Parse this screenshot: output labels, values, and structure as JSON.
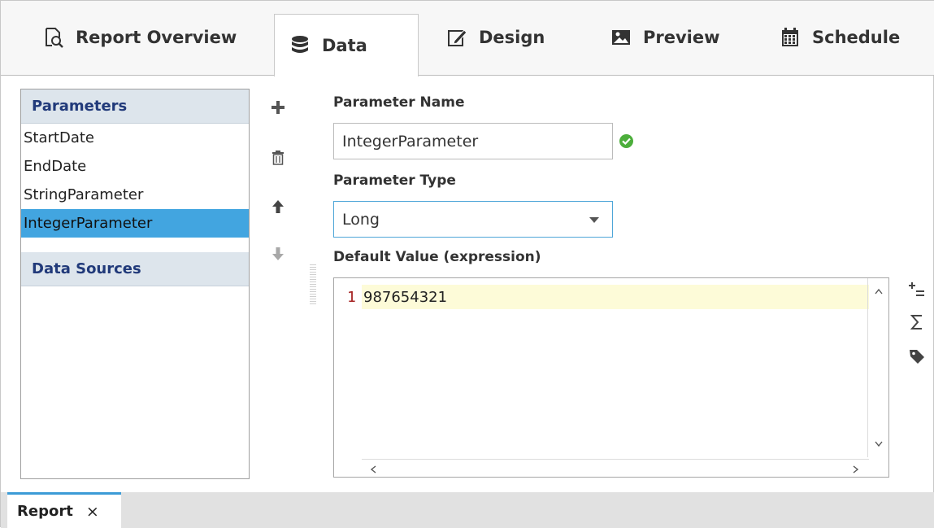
{
  "tabs": [
    {
      "label": "Report Overview",
      "icon": "report-overview-icon"
    },
    {
      "label": "Data",
      "icon": "database-icon"
    },
    {
      "label": "Design",
      "icon": "design-edit-icon"
    },
    {
      "label": "Preview",
      "icon": "image-preview-icon"
    },
    {
      "label": "Schedule",
      "icon": "calendar-icon"
    }
  ],
  "active_tab": "Data",
  "left_panel": {
    "parameters_header": "Parameters",
    "parameters": [
      "StartDate",
      "EndDate",
      "StringParameter",
      "IntegerParameter"
    ],
    "selected_parameter": "IntegerParameter",
    "datasources_header": "Data Sources"
  },
  "form": {
    "param_name_label": "Parameter Name",
    "param_name_value": "IntegerParameter",
    "param_type_label": "Parameter Type",
    "param_type_value": "Long",
    "default_value_label": "Default Value (expression)"
  },
  "editor": {
    "line_number": "1",
    "code": "987654321"
  },
  "bottom": {
    "tab_label": "Report",
    "close_glyph": "×"
  },
  "colors": {
    "accent": "#3c9bd6",
    "selection": "#42a5e0",
    "section_header_bg": "#dde5ec",
    "section_header_text": "#213a7a",
    "valid_green": "#4cae3b",
    "editor_line_highlight": "#fdfbd8"
  }
}
